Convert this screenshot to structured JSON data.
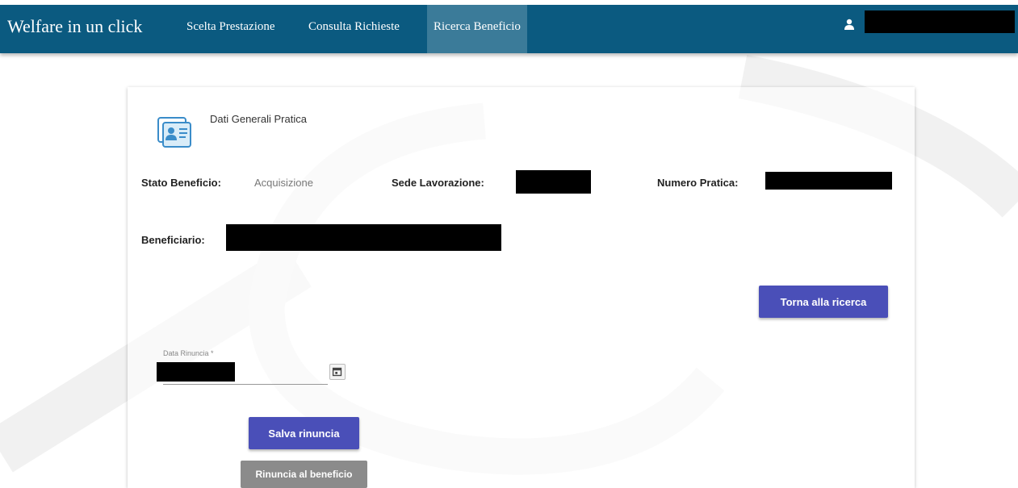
{
  "header": {
    "brand": "Welfare in un click",
    "nav_items": [
      {
        "label": "Scelta Prestazione",
        "active": false
      },
      {
        "label": "Consulta Richieste",
        "active": false
      },
      {
        "label": "Ricerca Beneficio",
        "active": true
      }
    ],
    "user_icon": "user-icon"
  },
  "card": {
    "section_icon": "id-card-icon",
    "section_title": "Dati Generali Pratica",
    "stato_beneficio": {
      "label": "Stato Beneficio:",
      "value": "Acquisizione"
    },
    "sede_lavorazione": {
      "label": "Sede Lavorazione:"
    },
    "numero_pratica": {
      "label": "Numero Pratica:"
    },
    "beneficiario": {
      "label": "Beneficiario:"
    },
    "torna_button": "Torna alla ricerca",
    "data_rinuncia": {
      "label": "Data Rinuncia *",
      "icon": "calendar-icon"
    },
    "salva_button": "Salva rinuncia",
    "rinuncia_button": "Rinuncia al beneficio"
  },
  "colors": {
    "navbar": "#0b5a80",
    "nav_active": "#3b7b99",
    "primary_button": "#4a4fb8",
    "secondary_button": "#8b8b8b"
  }
}
